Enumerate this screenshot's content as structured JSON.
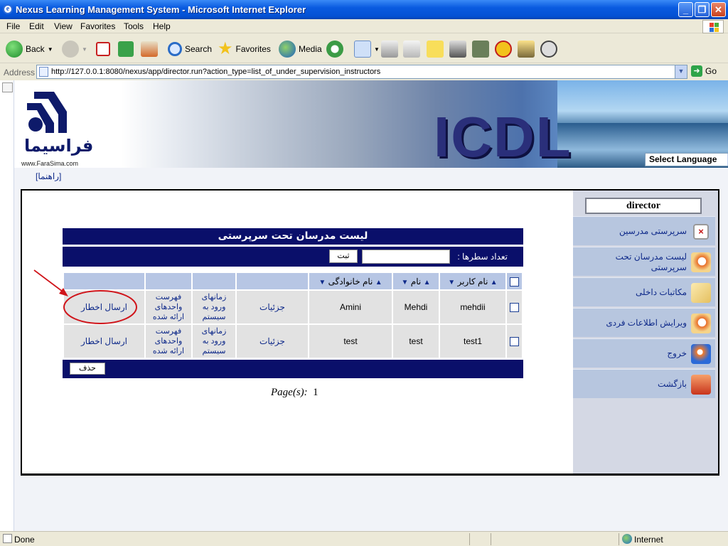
{
  "window": {
    "title": "Nexus Learning Management System - Microsoft Internet Explorer",
    "min": "_",
    "max": "❐",
    "close": "✕"
  },
  "menu": [
    "File",
    "Edit",
    "View",
    "Favorites",
    "Tools",
    "Help"
  ],
  "toolbar": {
    "back": "Back",
    "search": "Search",
    "favorites": "Favorites",
    "media": "Media"
  },
  "address": {
    "label": "Address",
    "url": "http://127.0.0.1:8080/nexus/app/director.run?action_type=list_of_under_supervision_instructors",
    "go": "Go"
  },
  "banner": {
    "logo_text": "فراسیما",
    "logo_url": "www.FaraSima.com",
    "brand": "ICDL",
    "language_select": "Select Language"
  },
  "help_link": "[راهنما]",
  "sidebar": {
    "user": "director",
    "items": [
      {
        "label": "سرپرستی مدرسین",
        "icon": "close-box-icon"
      },
      {
        "label": "لیست مدرسان تحت سرپرستی",
        "icon": "magnifier-icon"
      },
      {
        "label": "مکاتبات داخلی",
        "icon": "envelope-icon"
      },
      {
        "label": "ویرایش اطلاعات فردی",
        "icon": "magnifier-icon"
      },
      {
        "label": "خروج",
        "icon": "exit-icon"
      },
      {
        "label": "بازگشت",
        "icon": "home-icon"
      }
    ]
  },
  "list": {
    "title": "لیست مدرسان تحت سرپرستی",
    "rows_label": "تعداد سطرها :",
    "rows_value": "",
    "submit": "ثبت",
    "columns": {
      "username": "نام کاربر",
      "first_name": "نام",
      "last_name": "نام خانوادگی"
    },
    "rows": [
      {
        "username": "mehdii",
        "first_name": "Mehdi",
        "last_name": "Amini",
        "details": "جزئیات",
        "login_times": "زمانهای ورود به سیستم",
        "units": "فهرست واحدهای ارائه شده",
        "warning": "ارسال اخطار"
      },
      {
        "username": "test1",
        "first_name": "test",
        "last_name": "test",
        "details": "جزئیات",
        "login_times": "زمانهای ورود به سیستم",
        "units": "فهرست واحدهای ارائه شده",
        "warning": "ارسال اخطار"
      }
    ],
    "delete": "حذف",
    "pager_label": "Page(s):",
    "pager_value": "1"
  },
  "status": {
    "text": "Done",
    "zone": "Internet"
  },
  "annotation_color": "#D0141A"
}
